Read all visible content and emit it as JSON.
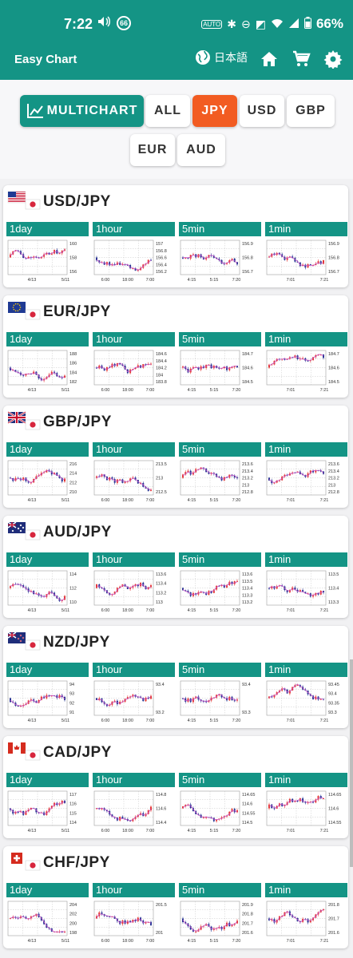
{
  "status_bar": {
    "time": "7:22",
    "notification_count": "66",
    "battery": "66%"
  },
  "app": {
    "title": "Easy Chart",
    "language": "日本語"
  },
  "tabs": [
    {
      "label": "MULTICHART",
      "kind": "multi"
    },
    {
      "label": "ALL",
      "kind": "normal"
    },
    {
      "label": "JPY",
      "kind": "active"
    },
    {
      "label": "USD",
      "kind": "normal"
    },
    {
      "label": "GBP",
      "kind": "normal"
    },
    {
      "label": "EUR",
      "kind": "normal"
    },
    {
      "label": "AUD",
      "kind": "normal"
    }
  ],
  "timeframes": [
    "1day",
    "1hour",
    "5min",
    "1min"
  ],
  "pairs": [
    {
      "name": "USD/JPY",
      "flag": "us",
      "charts": [
        {
          "y": [
            "160",
            "158",
            "156"
          ],
          "x": [
            "4/13",
            "5/11"
          ]
        },
        {
          "y": [
            "157",
            "156.8",
            "156.6",
            "156.4",
            "156.2"
          ],
          "x": [
            "6:00",
            "18:00",
            "7:00"
          ]
        },
        {
          "y": [
            "156.9",
            "156.8",
            "156.7"
          ],
          "x": [
            "4:15",
            "5:15",
            "7:20"
          ]
        },
        {
          "y": [
            "156.9",
            "156.8",
            "156.7"
          ],
          "x": [
            "7:01",
            "7:21"
          ]
        }
      ]
    },
    {
      "name": "EUR/JPY",
      "flag": "eu",
      "charts": [
        {
          "y": [
            "188",
            "186",
            "184",
            "182"
          ],
          "x": [
            "4/13",
            "5/11"
          ]
        },
        {
          "y": [
            "184.6",
            "184.4",
            "184.2",
            "184",
            "183.8"
          ],
          "x": [
            "6:00",
            "18:00",
            "7:00"
          ]
        },
        {
          "y": [
            "184.7",
            "184.6",
            "184.5"
          ],
          "x": [
            "4:15",
            "5:15",
            "7:20"
          ]
        },
        {
          "y": [
            "184.7",
            "184.6",
            "184.5"
          ],
          "x": [
            "7:01",
            "7:21"
          ]
        }
      ]
    },
    {
      "name": "GBP/JPY",
      "flag": "gb",
      "charts": [
        {
          "y": [
            "216",
            "214",
            "212",
            "210"
          ],
          "x": [
            "4/13",
            "5/11"
          ]
        },
        {
          "y": [
            "213.5",
            "213",
            "212.5"
          ],
          "x": [
            "6:00",
            "18:00",
            "7:00"
          ]
        },
        {
          "y": [
            "213.6",
            "213.4",
            "213.2",
            "213",
            "212.8"
          ],
          "x": [
            "4:15",
            "5:15",
            "7:20"
          ]
        },
        {
          "y": [
            "213.6",
            "213.4",
            "213.2",
            "213",
            "212.8"
          ],
          "x": [
            "7:01",
            "7:21"
          ]
        }
      ]
    },
    {
      "name": "AUD/JPY",
      "flag": "au",
      "charts": [
        {
          "y": [
            "114",
            "112",
            "110"
          ],
          "x": [
            "4/13",
            "5/11"
          ]
        },
        {
          "y": [
            "113.6",
            "113.4",
            "113.2",
            "113"
          ],
          "x": [
            "6:00",
            "18:00",
            "7:00"
          ]
        },
        {
          "y": [
            "113.6",
            "113.5",
            "113.4",
            "113.3",
            "113.2"
          ],
          "x": [
            "4:15",
            "5:15",
            "7:20"
          ]
        },
        {
          "y": [
            "113.5",
            "113.4",
            "113.3"
          ],
          "x": [
            "7:01",
            "7:21"
          ]
        }
      ]
    },
    {
      "name": "NZD/JPY",
      "flag": "nz",
      "charts": [
        {
          "y": [
            "94",
            "93",
            "92",
            "91"
          ],
          "x": [
            "4/13",
            "5/11"
          ]
        },
        {
          "y": [
            "93.4",
            "93.2"
          ],
          "x": [
            "6:00",
            "18:00",
            "7:00"
          ]
        },
        {
          "y": [
            "93.4",
            "93.3"
          ],
          "x": [
            "4:15",
            "5:15",
            "7:20"
          ]
        },
        {
          "y": [
            "93.45",
            "93.4",
            "93.35",
            "93.3"
          ],
          "x": [
            "7:01",
            "7:21"
          ]
        }
      ]
    },
    {
      "name": "CAD/JPY",
      "flag": "ca",
      "charts": [
        {
          "y": [
            "117",
            "116",
            "115",
            "114"
          ],
          "x": [
            "4/13",
            "5/11"
          ]
        },
        {
          "y": [
            "114.8",
            "114.6",
            "114.4"
          ],
          "x": [
            "6:00",
            "18:00",
            "7:00"
          ]
        },
        {
          "y": [
            "114.65",
            "114.6",
            "114.55",
            "114.5"
          ],
          "x": [
            "4:15",
            "5:15",
            "7:20"
          ]
        },
        {
          "y": [
            "114.65",
            "114.6",
            "114.55"
          ],
          "x": [
            "7:01",
            "7:21"
          ]
        }
      ]
    },
    {
      "name": "CHF/JPY",
      "flag": "ch",
      "charts": [
        {
          "y": [
            "204",
            "202",
            "200",
            "198"
          ],
          "x": [
            "4/13",
            "5/11"
          ]
        },
        {
          "y": [
            "201.5",
            "201"
          ],
          "x": [
            "6:00",
            "18:00",
            "7:00"
          ]
        },
        {
          "y": [
            "201.9",
            "201.8",
            "201.7",
            "201.6"
          ],
          "x": [
            "4:15",
            "5:15",
            "7:20"
          ]
        },
        {
          "y": [
            "201.8",
            "201.7",
            "201.6"
          ],
          "x": [
            "7:01",
            "7:21"
          ]
        }
      ]
    }
  ],
  "colors": {
    "accent": "#149485",
    "active_tab": "#f25c22",
    "bull": "#e53935",
    "bear": "#283593",
    "ma": "#c653c6",
    "ma2": "#2ec4b6"
  }
}
